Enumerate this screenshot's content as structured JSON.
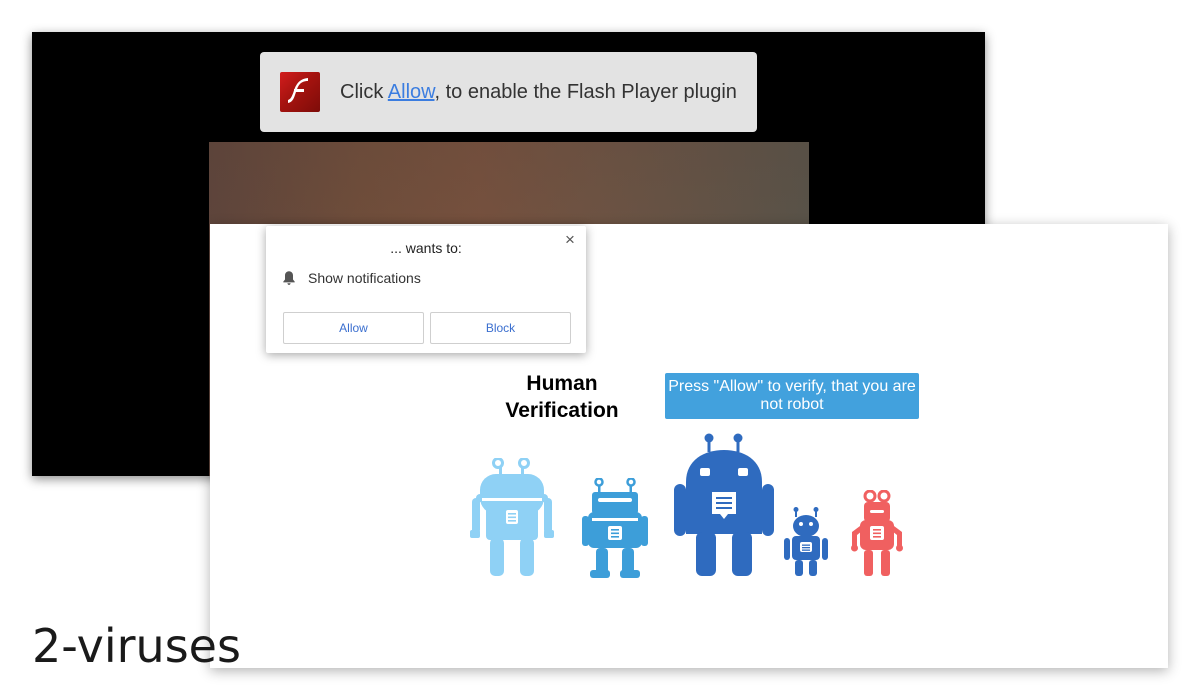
{
  "flash_banner": {
    "text_before": "Click ",
    "link_text": "Allow",
    "text_after": ", to enable the Flash Player plugin"
  },
  "notification_prompt": {
    "title": "... wants to:",
    "permission": "Show notifications",
    "allow_label": "Allow",
    "block_label": "Block",
    "close_glyph": "×"
  },
  "verification": {
    "title_line1": "Human",
    "title_line2": "Verification",
    "cta_text": "Press \"Allow\" to verify, that you are not robot"
  },
  "robots": [
    {
      "name": "robot-light-blue",
      "color": "#8fd1f5"
    },
    {
      "name": "robot-sky-blue",
      "color": "#3d9ed9"
    },
    {
      "name": "robot-navy-large",
      "color": "#2f6bbf"
    },
    {
      "name": "robot-navy-small",
      "color": "#2f6bbf"
    },
    {
      "name": "robot-red",
      "color": "#f06060"
    }
  ],
  "colors": {
    "cta_blue": "#42a1dd",
    "link_blue": "#3b7de0",
    "flash_red": "#c8191b"
  },
  "icons": {
    "flash": "flash-player-icon",
    "bell": "bell-icon",
    "close": "close-icon"
  },
  "watermark": "2-viruses"
}
